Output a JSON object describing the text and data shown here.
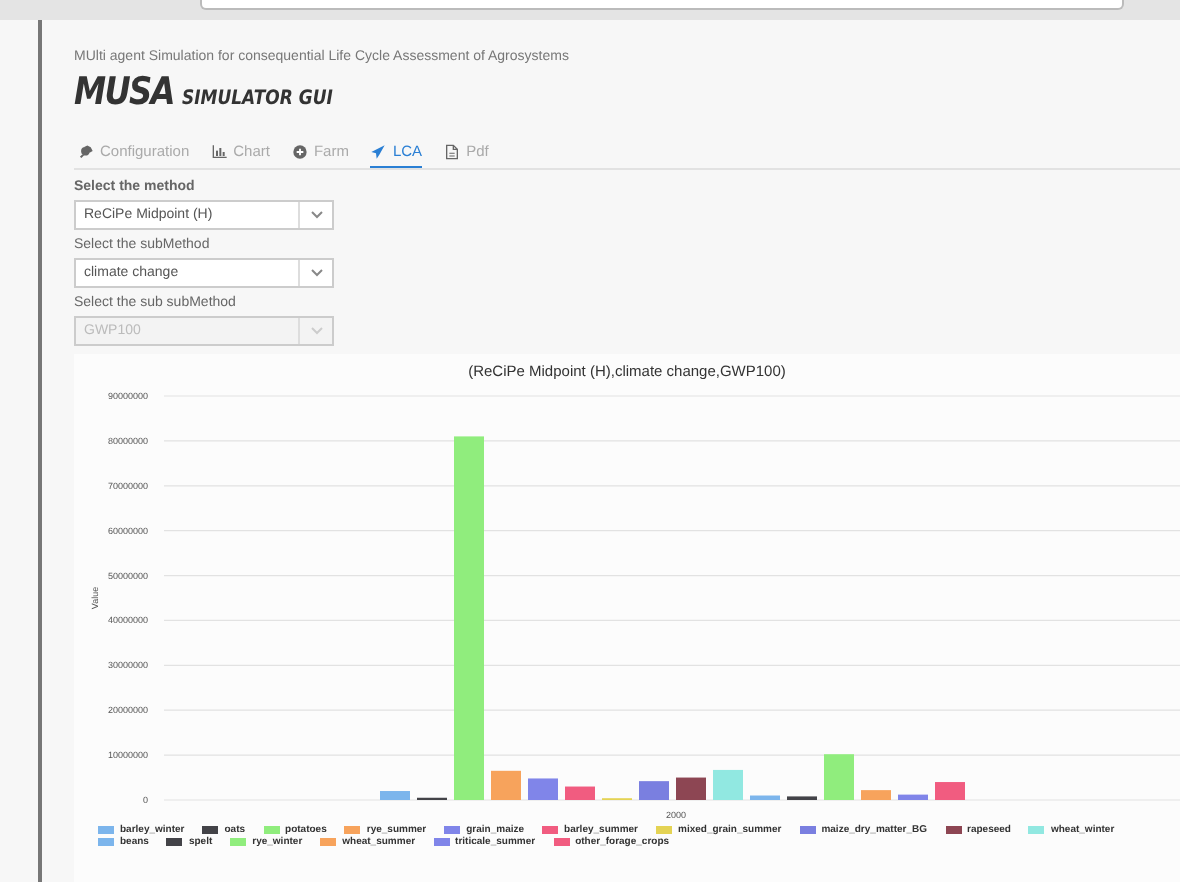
{
  "header": {
    "subtitle": "MUlti agent Simulation for consequential Life Cycle Assessment of Agrosystems",
    "logo_main": "MUSA",
    "logo_sub": "SIMULATOR GUI"
  },
  "tabs": [
    {
      "label": "Configuration",
      "selected": false
    },
    {
      "label": "Chart",
      "selected": false
    },
    {
      "label": "Farm",
      "selected": false
    },
    {
      "label": "LCA",
      "selected": true
    },
    {
      "label": "Pdf",
      "selected": false
    }
  ],
  "selects": [
    {
      "label": "Select the method",
      "value": "ReCiPe Midpoint (H)",
      "disabled": false
    },
    {
      "label": "Select the subMethod",
      "value": "climate change",
      "disabled": false
    },
    {
      "label": "Select the sub subMethod",
      "value": "GWP100",
      "disabled": true
    }
  ],
  "chart": {
    "chart_data": {
      "type": "bar",
      "title": "(ReCiPe Midpoint (H),climate change,GWP100)",
      "ylabel": "Value",
      "grid": true,
      "legend": "bottom",
      "categories": [
        "2000"
      ],
      "ylim": [
        0,
        90000000
      ],
      "yticks": [
        0,
        10000000,
        20000000,
        30000000,
        40000000,
        50000000,
        60000000,
        70000000,
        80000000,
        90000000
      ],
      "series": [
        {
          "name": "barley_winter",
          "color": "#7cb5ec",
          "values": [
            2000000
          ]
        },
        {
          "name": "oats",
          "color": "#434348",
          "values": [
            500000
          ]
        },
        {
          "name": "potatoes",
          "color": "#90ed7d",
          "values": [
            81000000
          ]
        },
        {
          "name": "rye_summer",
          "color": "#f7a35c",
          "values": [
            6500000
          ]
        },
        {
          "name": "grain_maize",
          "color": "#8085e9",
          "values": [
            4800000
          ]
        },
        {
          "name": "barley_summer",
          "color": "#f15c80",
          "values": [
            3000000
          ]
        },
        {
          "name": "mixed_grain_summer",
          "color": "#e4d354",
          "values": [
            400000
          ]
        },
        {
          "name": "maize_dry_matter_BG",
          "color": "#7a7fe0",
          "values": [
            4200000
          ]
        },
        {
          "name": "rapeseed",
          "color": "#8d4653",
          "values": [
            5000000
          ]
        },
        {
          "name": "wheat_winter",
          "color": "#91e8e1",
          "values": [
            6700000
          ]
        },
        {
          "name": "beans",
          "color": "#7cb5ec",
          "values": [
            1000000
          ]
        },
        {
          "name": "spelt",
          "color": "#434348",
          "values": [
            800000
          ]
        },
        {
          "name": "rye_winter",
          "color": "#90ed7d",
          "values": [
            10200000
          ]
        },
        {
          "name": "wheat_summer",
          "color": "#f7a35c",
          "values": [
            2200000
          ]
        },
        {
          "name": "triticale_summer",
          "color": "#8085e9",
          "values": [
            1200000
          ]
        },
        {
          "name": "other_forage_crops",
          "color": "#f15c80",
          "values": [
            4000000
          ]
        }
      ]
    }
  }
}
